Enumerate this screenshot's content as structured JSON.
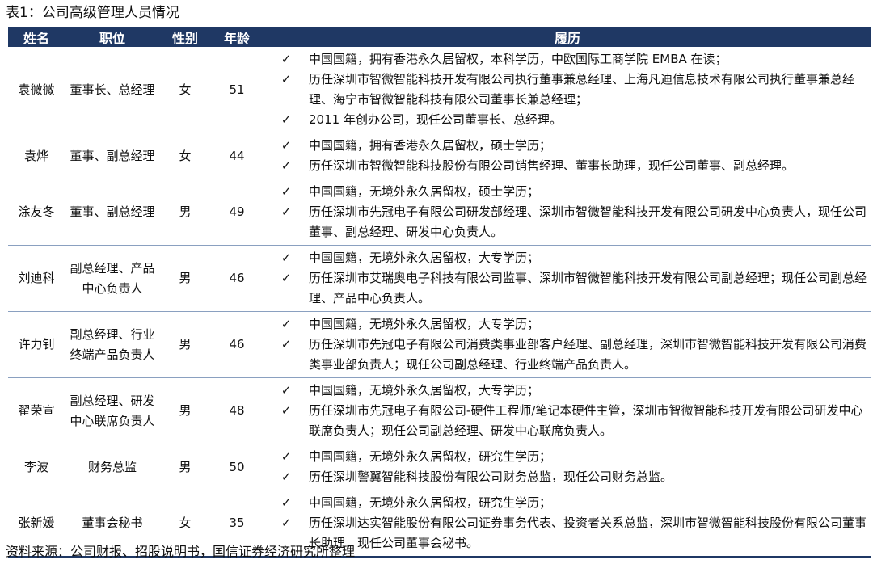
{
  "caption": "表1：公司高级管理人员情况",
  "headers": {
    "name": "姓名",
    "position": "职位",
    "gender": "性别",
    "age": "年龄",
    "resume": "履历"
  },
  "check_mark": "✓",
  "rows": [
    {
      "name": "袁微微",
      "position": "董事长、总经理",
      "gender": "女",
      "age": "51",
      "resume": [
        "中国国籍，拥有香港永久居留权，本科学历，中欧国际工商学院 EMBA 在读；",
        "历任深圳市智微智能科技开发有限公司执行董事兼总经理、上海凡迪信息技术有限公司执行董事兼总经理、海宁市智微智能科技有限公司董事长兼总经理；",
        "2011 年创办公司，现任公司董事长、总经理。"
      ]
    },
    {
      "name": "袁烨",
      "position": "董事、副总经理",
      "gender": "女",
      "age": "44",
      "resume": [
        "中国国籍，拥有香港永久居留权，硕士学历；",
        "历任深圳市智微智能科技股份有限公司销售经理、董事长助理，现任公司董事、副总经理。"
      ]
    },
    {
      "name": "涂友冬",
      "position": "董事、副总经理",
      "gender": "男",
      "age": "49",
      "resume": [
        "中国国籍，无境外永久居留权，硕士学历；",
        "历任深圳市先冠电子有限公司研发部经理、深圳市智微智能科技开发有限公司研发中心负责人，现任公司董事、副总经理、研发中心负责人。"
      ]
    },
    {
      "name": "刘迪科",
      "position": "副总经理、产品中心负责人",
      "gender": "男",
      "age": "46",
      "resume": [
        "中国国籍，无境外永久居留权，大专学历；",
        "历任深圳市艾瑞奥电子科技有限公司监事、深圳市智微智能科技开发有限公司副总经理；现任公司副总经理、产品中心负责人。"
      ]
    },
    {
      "name": "许力钊",
      "position": "副总经理、行业终端产品负责人",
      "gender": "男",
      "age": "46",
      "resume": [
        "中国国籍，无境外永久居留权，大专学历；",
        "历任深圳市先冠电子有限公司消费类事业部客户经理、副总经理，深圳市智微智能科技开发有限公司消费类事业部负责人；现任公司副总经理、行业终端产品负责人。"
      ]
    },
    {
      "name": "翟荣宣",
      "position": "副总经理、研发中心联席负责人",
      "gender": "男",
      "age": "48",
      "resume": [
        "中国国籍，无境外永久居留权，大专学历；",
        "历任深圳市先冠电子有限公司-硬件工程师/笔记本硬件主管，深圳市智微智能科技开发有限公司研发中心联席负责人；现任公司副总经理、研发中心联席负责人。"
      ]
    },
    {
      "name": "李波",
      "position": "财务总监",
      "gender": "男",
      "age": "50",
      "resume": [
        "中国国籍，无境外永久居留权，研究生学历；",
        "历任深圳警翼智能科技股份有限公司财务总监，现任公司财务总监。"
      ]
    },
    {
      "name": "张新媛",
      "position": "董事会秘书",
      "gender": "女",
      "age": "35",
      "resume": [
        "中国国籍，无境外永久居留权，研究生学历；",
        "历任深圳达实智能股份有限公司证券事务代表、投资者关系总监，深圳市智微智能科技股份有限公司董事长助理，现任公司董事会秘书。"
      ]
    }
  ],
  "source": "资料来源：公司财报、招股说明书，国信证券经济研究所整理"
}
